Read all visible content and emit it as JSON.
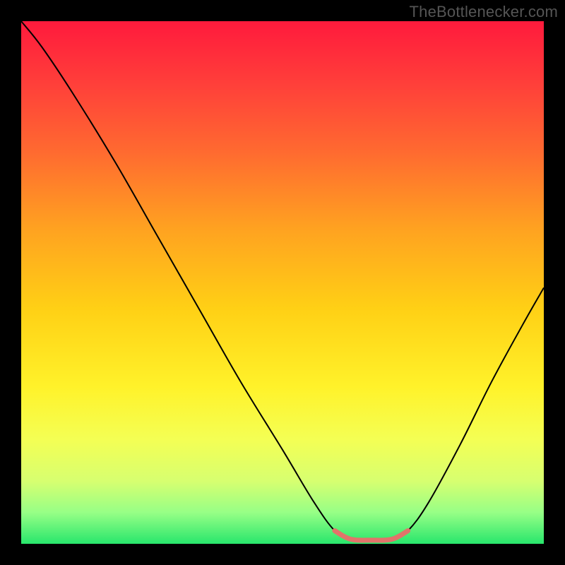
{
  "watermark": "TheBottlenecker.com",
  "chart_data": {
    "type": "line",
    "title": "",
    "xlabel": "",
    "ylabel": "",
    "xlim": [
      0,
      100
    ],
    "ylim": [
      0,
      100
    ],
    "background_gradient": {
      "stops": [
        {
          "offset": 0.0,
          "color": "#ff1a3c"
        },
        {
          "offset": 0.12,
          "color": "#ff3f3a"
        },
        {
          "offset": 0.25,
          "color": "#ff6a30"
        },
        {
          "offset": 0.4,
          "color": "#ffa320"
        },
        {
          "offset": 0.55,
          "color": "#ffd015"
        },
        {
          "offset": 0.7,
          "color": "#fff22a"
        },
        {
          "offset": 0.8,
          "color": "#f4ff54"
        },
        {
          "offset": 0.88,
          "color": "#d7ff70"
        },
        {
          "offset": 0.94,
          "color": "#97ff86"
        },
        {
          "offset": 1.0,
          "color": "#28e66c"
        }
      ]
    },
    "curve": {
      "color": "#000000",
      "width": 2,
      "points": [
        {
          "x": 0,
          "y": 100
        },
        {
          "x": 4,
          "y": 95
        },
        {
          "x": 10,
          "y": 86
        },
        {
          "x": 18,
          "y": 73
        },
        {
          "x": 26,
          "y": 59
        },
        {
          "x": 34,
          "y": 45
        },
        {
          "x": 42,
          "y": 31
        },
        {
          "x": 50,
          "y": 18
        },
        {
          "x": 56,
          "y": 8
        },
        {
          "x": 60,
          "y": 2.5
        },
        {
          "x": 63,
          "y": 0.8
        },
        {
          "x": 67,
          "y": 0.6
        },
        {
          "x": 71,
          "y": 0.8
        },
        {
          "x": 74,
          "y": 2.5
        },
        {
          "x": 78,
          "y": 8
        },
        {
          "x": 84,
          "y": 19
        },
        {
          "x": 90,
          "y": 31
        },
        {
          "x": 96,
          "y": 42
        },
        {
          "x": 100,
          "y": 49
        }
      ]
    },
    "highlight": {
      "color": "#e2736a",
      "width": 7,
      "points": [
        {
          "x": 60,
          "y": 2.5
        },
        {
          "x": 63,
          "y": 0.9
        },
        {
          "x": 67,
          "y": 0.7
        },
        {
          "x": 71,
          "y": 0.9
        },
        {
          "x": 74,
          "y": 2.5
        }
      ]
    }
  }
}
